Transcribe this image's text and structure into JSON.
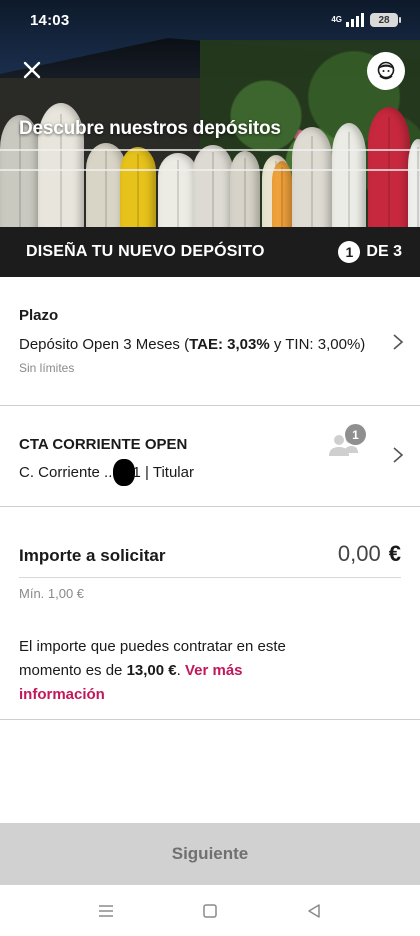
{
  "status_bar": {
    "time": "14:03",
    "network": "4G",
    "battery": "28"
  },
  "hero": {
    "title": "Descubre nuestros depósitos",
    "close_icon": "close-icon",
    "avatar_icon": "user-avatar-icon"
  },
  "steps": {
    "title": "DISEÑA TU NUEVO DEPÓSITO",
    "current": "1",
    "total_label": "DE 3"
  },
  "plazo": {
    "title": "Plazo",
    "product": "Depósito Open 3 Meses (",
    "tae_label": "TAE: 3,03%",
    "tin_label": " y TIN: 3,00%)",
    "limits": "Sin límites"
  },
  "account": {
    "title": "CTA CORRIENTE OPEN",
    "prefix": "C. Corriente ...",
    "suffix": "1 | Titular",
    "holders_count": "1"
  },
  "importe": {
    "label": "Importe a solicitar",
    "value": "0,00",
    "currency": "€",
    "min": "Mín. 1,00 €",
    "info_prefix": "El importe que puedes contratar en este momento es de ",
    "info_amount": "13,00 €",
    "info_dot": ". ",
    "link": "Ver más información"
  },
  "footer": {
    "next_label": "Siguiente"
  },
  "colors": {
    "accent": "#c2185b",
    "steps_bg": "#1c1c1c",
    "button_disabled": "#d1d1d1"
  }
}
